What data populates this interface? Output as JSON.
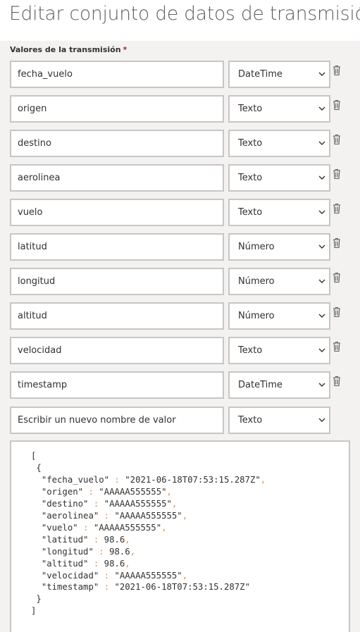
{
  "title": "Editar conjunto de datos de transmisión",
  "section_label": "Valores de la transmisión",
  "required_mark": "*",
  "fields": [
    {
      "name": "fecha_vuelo",
      "type": "DateTime"
    },
    {
      "name": "origen",
      "type": "Texto"
    },
    {
      "name": "destino",
      "type": "Texto"
    },
    {
      "name": "aerolinea",
      "type": "Texto"
    },
    {
      "name": "vuelo",
      "type": "Texto"
    },
    {
      "name": "latitud",
      "type": "Número"
    },
    {
      "name": "longitud",
      "type": "Número"
    },
    {
      "name": "altitud",
      "type": "Número"
    },
    {
      "name": "velocidad",
      "type": "Texto"
    },
    {
      "name": "timestamp",
      "type": "DateTime"
    }
  ],
  "new_field": {
    "placeholder": "Escribir un nuevo nombre de valor",
    "type": "Texto"
  },
  "json_open_bracket": "[",
  "json_open_brace": "{",
  "json_close_brace": "}",
  "json_close_bracket": "]",
  "json_entries": [
    {
      "key": "\"fecha_vuelo\"",
      "value": "\"2021-06-18T07:53:15.287Z\""
    },
    {
      "key": "\"origen\"",
      "value": "\"AAAAA555555\""
    },
    {
      "key": "\"destino\"",
      "value": "\"AAAAA555555\""
    },
    {
      "key": "\"aerolinea\"",
      "value": "\"AAAAA555555\""
    },
    {
      "key": "\"vuelo\"",
      "value": "\"AAAAA555555\""
    },
    {
      "key": "\"latitud\"",
      "value": "98.6"
    },
    {
      "key": "\"longitud\"",
      "value": "98.6"
    },
    {
      "key": "\"altitud\"",
      "value": "98.6"
    },
    {
      "key": "\"velocidad\"",
      "value": "\"AAAAA555555\""
    },
    {
      "key": "\"timestamp\"",
      "value": "\"2021-06-18T07:53:15.287Z\""
    }
  ],
  "colors": {
    "accent_punct": "#e88a44",
    "border": "#c8c6c4",
    "panel_bg": "#f3f2f1"
  }
}
